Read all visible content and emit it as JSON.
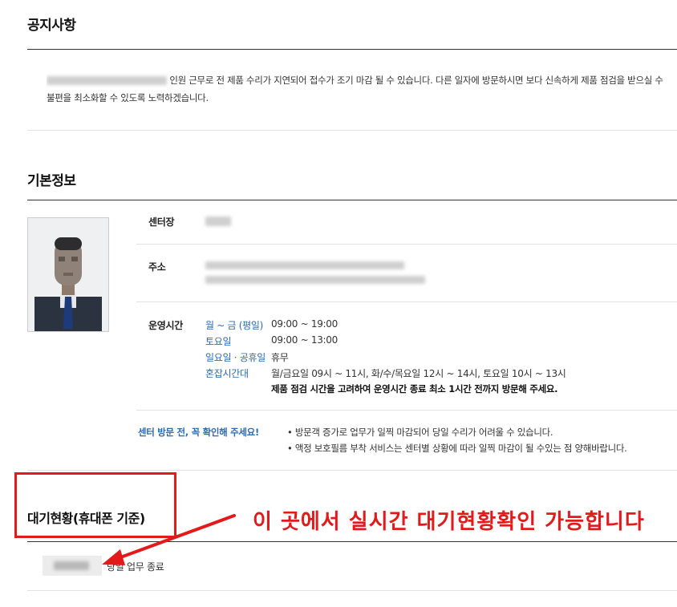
{
  "notice": {
    "title": "공지사항",
    "line1": "인원 근무로 전 제품 수리가 지연되어 접수가 조기 마감 될 수 있습니다. 다른 일자에 방문하시면 보다 신속하게 제품 점검을 받으실 수",
    "line2": "불편을 최소화할 수 있도록 노력하겠습니다."
  },
  "basic": {
    "title": "기본정보",
    "manager_label": "센터장",
    "address_label": "주소",
    "hours_label": "운영시간",
    "hours": [
      {
        "day": "월 ~ 금 (평일)",
        "time": "09:00 ~ 19:00"
      },
      {
        "day": "토요일",
        "time": "09:00 ~ 13:00"
      },
      {
        "day": "일요일 · 공휴일",
        "time": "휴무"
      },
      {
        "day": "혼잡시간대",
        "time": "월/금요일 09시 ~ 11시, 화/수/목요일 12시 ~ 14시, 토요일 10시 ~ 13시"
      }
    ],
    "hours_note": "제품 점검 시간을 고려하여 운영시간 종료 최소 1시간 전까지 방문해 주세요.",
    "visit_label": "센터 방문 전, 꼭 확인해 주세요!",
    "visit_bullets": [
      "방문객 증가로 업무가 일찍 마감되어 당일 수리가 어려울 수 있습니다.",
      "액정 보호필름 부착 서비스는 센터별 상황에 따라 일찍 마감이 될 수있는 점 양해바랍니다."
    ]
  },
  "waiting": {
    "title": "대기현황(휴대폰 기준)",
    "status_text": "당일 업무 종료"
  },
  "annotation": {
    "text": "이 곳에서 실시간 대기현황확인 가능합니다",
    "color": "#e21a1a"
  },
  "colors": {
    "link_blue": "#2a6bb5",
    "accent_red": "#e21a1a"
  }
}
